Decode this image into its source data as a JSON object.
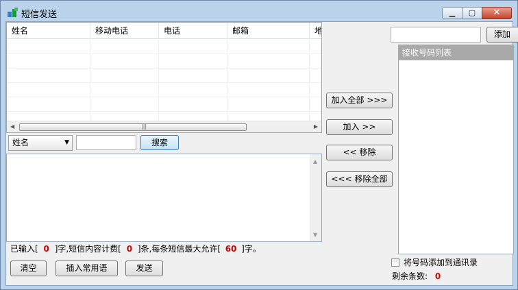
{
  "window": {
    "title": "短信发送",
    "controls": {
      "minimize": "▁",
      "maximize": "▢",
      "close": "✕"
    }
  },
  "contacts_table": {
    "columns": [
      "姓名",
      "移动电话",
      "电话",
      "邮箱",
      "地"
    ],
    "rows": []
  },
  "search": {
    "field_options": [
      "姓名"
    ],
    "selected_field": "姓名",
    "query": "",
    "button_label": "搜索"
  },
  "transfer_buttons": {
    "add_all": "加入全部 >>>",
    "add": "加入 >>",
    "remove": "<< 移除",
    "remove_all": "<<< 移除全部"
  },
  "add_number": {
    "input_value": "",
    "button_label": "添加"
  },
  "recipients": {
    "header": "接收号码列表",
    "items": []
  },
  "message": {
    "content": ""
  },
  "status": {
    "prefix": "已输入[",
    "chars": "0",
    "mid1": "]字,短信内容计费[",
    "count": "0",
    "mid2": "]条,每条短信最大允许[",
    "max": "60",
    "suffix": "]字。"
  },
  "actions": {
    "clear": "清空",
    "insert_phrase": "插入常用语",
    "send": "发送"
  },
  "save_to_contacts": {
    "label": "将号码添加到通讯录",
    "checked": false
  },
  "remaining": {
    "label": "剩余条数:",
    "value": "0"
  },
  "colors": {
    "title_bg": "#bcd3ec",
    "list_header_bg": "#a9a9a9",
    "counter_red": "#d00000",
    "close_red": "#c7432b"
  }
}
